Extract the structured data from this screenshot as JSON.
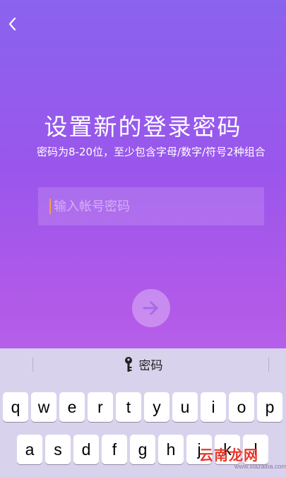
{
  "header": {
    "back_icon": "chevron-left-icon"
  },
  "main": {
    "title": "设置新的登录密码",
    "subtitle": "密码为8-20位，至少包含字母/数字/符号2种组合",
    "password_placeholder": "输入帐号密码",
    "next_icon": "arrow-right-icon"
  },
  "keyboard": {
    "bar_label": "密码",
    "bar_icon": "key-icon",
    "row1": [
      "q",
      "w",
      "e",
      "r",
      "t",
      "y",
      "u",
      "i",
      "o",
      "p"
    ],
    "row2": [
      "a",
      "s",
      "d",
      "f",
      "g",
      "h",
      "j",
      "k",
      "l"
    ]
  },
  "watermark": {
    "text": "云南龙网",
    "sub": "www.xiazaiba.com"
  }
}
